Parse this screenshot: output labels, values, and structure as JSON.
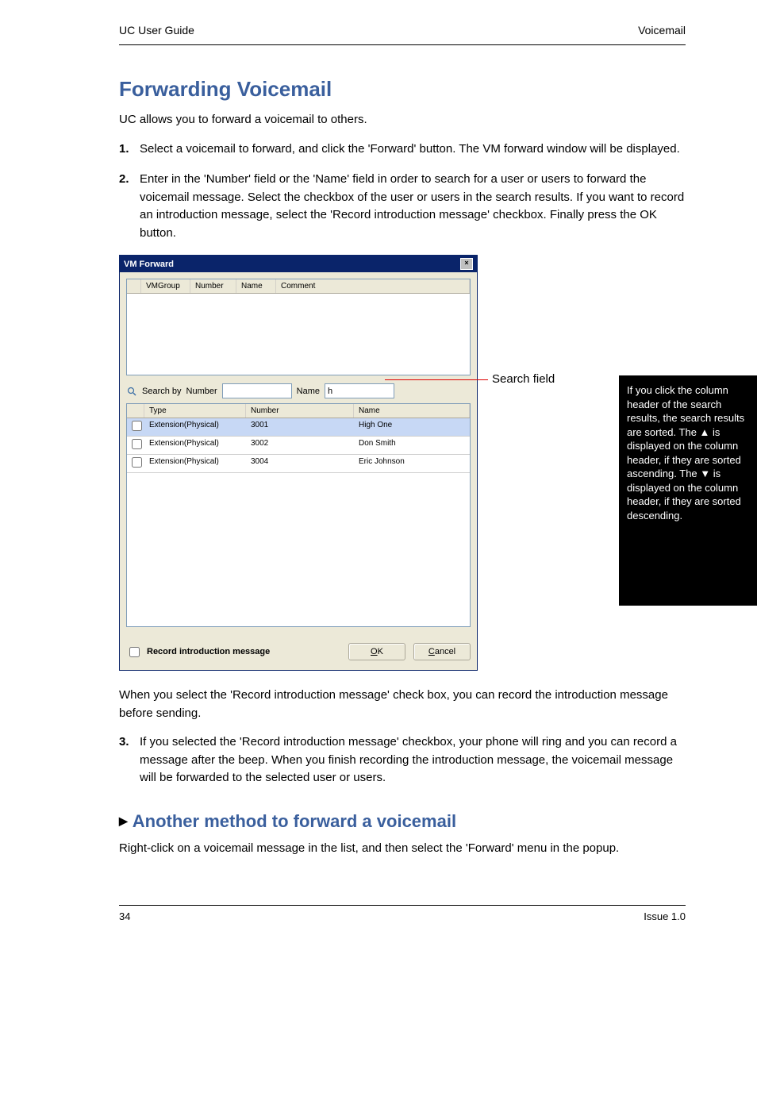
{
  "page_header": {
    "left": "UC User Guide",
    "right": "Voicemail"
  },
  "section_title": "Forwarding Voicemail",
  "intro": "UC allows you to forward a voicemail to others.",
  "step1": {
    "num": "1.",
    "text": "Select a voicemail to forward, and click the 'Forward' button. The VM forward window will be displayed."
  },
  "step2": {
    "num": "2.",
    "text": "Enter in the 'Number' field or the 'Name' field in order to search for a user or users to forward the voicemail message. Select the checkbox of the user or users in the search results. If you want to record an introduction message, select the 'Record introduction message' checkbox. Finally press the OK button."
  },
  "step3": {
    "num": "3.",
    "text": "If you selected the 'Record introduction message' checkbox, your phone will ring and you can record a message after the beep. When you finish recording the introduction message, the voicemail message will be forwarded to the selected user or users."
  },
  "dialog": {
    "title": "VM Forward",
    "close_symbol": "×",
    "grid_top_headers": [
      "",
      "VMGroup",
      "Number",
      "Name",
      "Comment"
    ],
    "search_label": "Search by",
    "search_number_label": "Number",
    "search_name_label": "Name",
    "search_name_value": "h",
    "grid_bottom_headers": {
      "type": "Type",
      "number": "Number",
      "name": "Name"
    },
    "grid_bottom_rows": [
      {
        "type": "Extension(Physical)",
        "number": "3001",
        "name": "High One",
        "selected": true
      },
      {
        "type": "Extension(Physical)",
        "number": "3002",
        "name": "Don Smith",
        "selected": false
      },
      {
        "type": "Extension(Physical)",
        "number": "3004",
        "name": "Eric Johnson",
        "selected": false
      }
    ],
    "record_label": "Record introduction message",
    "ok_label": "OK",
    "cancel_label": "Cancel"
  },
  "callout": "Search field",
  "side_note": "If you click the column header of the search results, the search results are sorted. The ▲ is displayed on the column header, if they are sorted ascending. The ▼ is displayed on the column header, if they are sorted descending.",
  "after_dialog_text": "When you select the 'Record introduction message' check box, you can record the introduction message before sending.",
  "sub_heading": "Another method to forward a voicemail",
  "sub_text": "Right-click on a voicemail message in the list, and then select the 'Forward' menu in the popup.",
  "footer": {
    "left": "34",
    "right": "Issue 1.0"
  }
}
